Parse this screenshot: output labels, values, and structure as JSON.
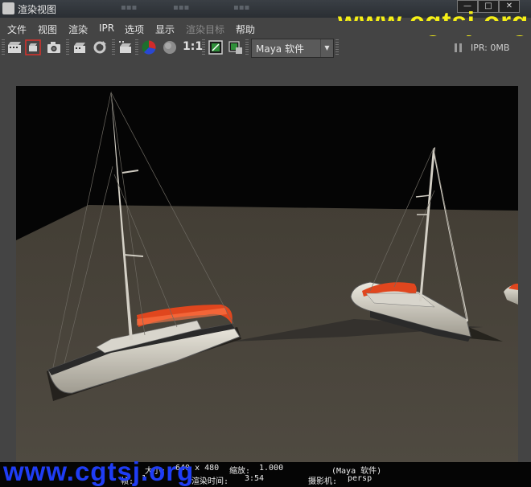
{
  "window": {
    "title": "渲染视图"
  },
  "watermark": {
    "text": "www.cgtsj.org",
    "top_color": "#f5ef16",
    "bottom_color": "#1f3df5"
  },
  "menu": {
    "items": [
      "文件",
      "视图",
      "渲染",
      "IPR",
      "选项",
      "显示",
      "渲染目标",
      "帮助"
    ],
    "disabled_item": "渲染目标"
  },
  "toolbar": {
    "ratio_label": "1:1",
    "renderer": "Maya 软件",
    "ipr_status": "IPR: 0MB"
  },
  "status": {
    "size_label": "大小:",
    "size_value": "640 x 480",
    "zoom_label": "缩放:",
    "zoom_value": "1.000",
    "renderer": "(Maya 软件)",
    "frame_label": "帧:",
    "frame_value": "1",
    "time_label": "渲染时间:",
    "time_value": "3:54",
    "camera_label": "摄影机:",
    "camera_value": "persp"
  },
  "colors": {
    "background": "#444444",
    "viewport_bg": "#050505",
    "floor": "#4c473e",
    "sail_accent": "#e0461e"
  }
}
